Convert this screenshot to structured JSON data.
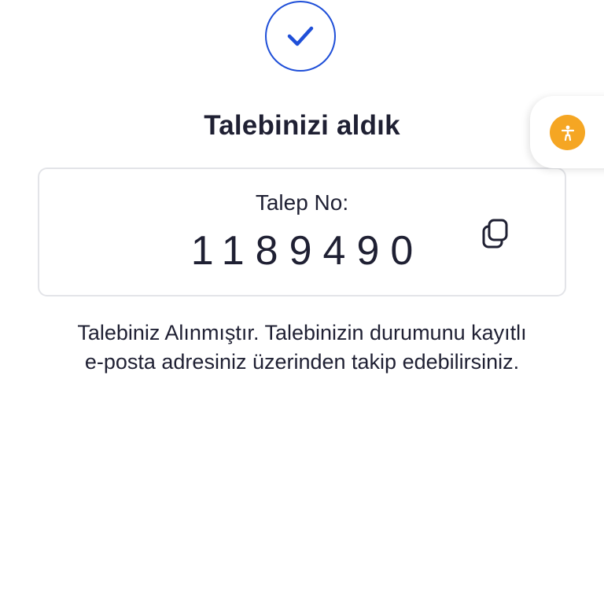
{
  "confirmation": {
    "icon": "check-icon",
    "title": "Talebinizi aldık",
    "accent_color": "#1f4fd8"
  },
  "request_card": {
    "label": "Talep No:",
    "number": "1189490",
    "copy_icon": "copy-icon"
  },
  "message": {
    "line1": "Talebiniz Alınmıştır. Talebinizin durumunu kayıtlı",
    "line2": "e-posta adresiniz üzerinden takip edebilirsiniz."
  },
  "accessibility": {
    "icon": "accessibility-person-icon",
    "color": "#f5a623"
  }
}
